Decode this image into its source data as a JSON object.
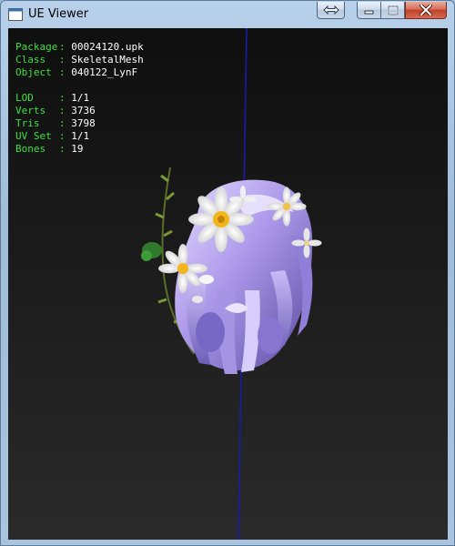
{
  "window": {
    "title": "UE Viewer"
  },
  "titlebar": {
    "buttons": [
      {
        "name": "extra-button",
        "icon": "double-arrow-icon"
      },
      {
        "name": "minimize-button",
        "icon": "minimize-icon"
      },
      {
        "name": "maximize-button",
        "icon": "maximize-icon"
      },
      {
        "name": "close-button",
        "icon": "close-icon"
      }
    ]
  },
  "info": {
    "package": {
      "label": "Package",
      "value": "00024120.upk"
    },
    "class": {
      "label": "Class",
      "value": "SkeletalMesh"
    },
    "object": {
      "label": "Object",
      "value": "040122_LynF"
    },
    "lod": {
      "label": "LOD",
      "value": "1/1"
    },
    "verts": {
      "label": "Verts",
      "value": "3736"
    },
    "tris": {
      "label": "Tris",
      "value": "3798"
    },
    "uvset": {
      "label": "UV Set",
      "value": "1/1"
    },
    "bones": {
      "label": "Bones",
      "value": "19"
    }
  },
  "colors": {
    "label_green": "#3fe03f",
    "value_white": "#ffffff",
    "axis_blue": "#1a1aa8",
    "hair_lavender": "#b9a8ee",
    "flower_white": "#f4f4f4",
    "flower_center": "#f2b51b"
  },
  "model": {
    "icon": "hair-with-flower-crown-mesh"
  }
}
